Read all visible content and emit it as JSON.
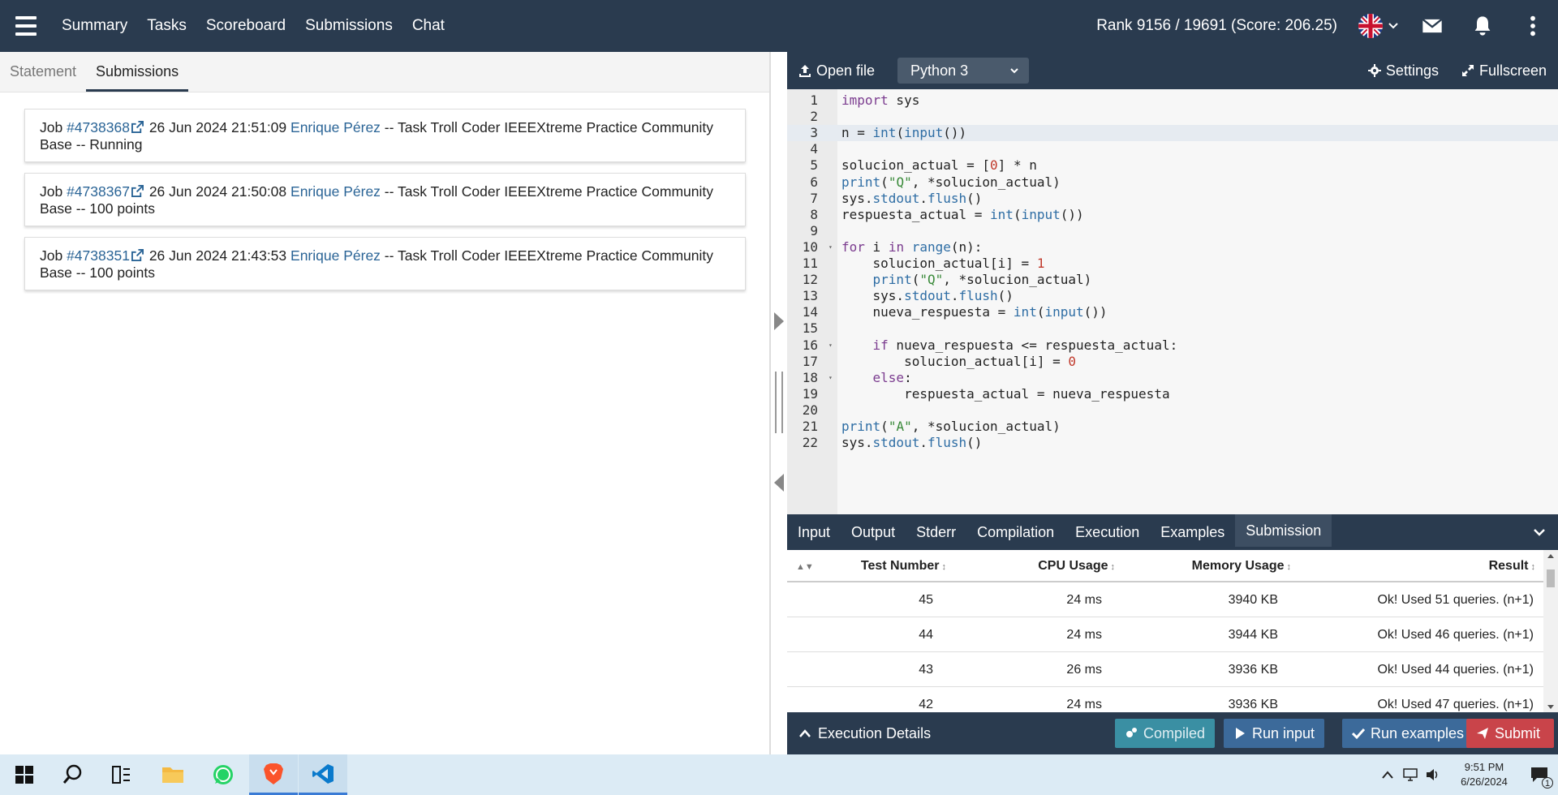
{
  "nav": {
    "links": [
      "Summary",
      "Tasks",
      "Scoreboard",
      "Submissions",
      "Chat"
    ],
    "rank": "Rank 9156 / 19691 (Score: 206.25)"
  },
  "left": {
    "tabs": [
      "Statement",
      "Submissions"
    ],
    "jobs": [
      {
        "prefix": "Job ",
        "id": "#4738368",
        "date": "26 Jun 2024 21:51:09",
        "user": "Enrique Pérez",
        "desc": " -- Task Troll Coder IEEEXtreme Practice Community Base -- Running"
      },
      {
        "prefix": "Job ",
        "id": "#4738367",
        "date": "26 Jun 2024 21:50:08",
        "user": "Enrique Pérez",
        "desc": " -- Task Troll Coder IEEEXtreme Practice Community Base -- 100 points"
      },
      {
        "prefix": "Job ",
        "id": "#4738351",
        "date": "26 Jun 2024 21:43:53",
        "user": "Enrique Pérez",
        "desc": " -- Task Troll Coder IEEEXtreme Practice Community Base -- 100 points"
      }
    ]
  },
  "editor": {
    "open_file": "Open file",
    "language": "Python 3",
    "settings": "Settings",
    "fullscreen": "Fullscreen",
    "lines": [
      "import sys",
      "",
      "n = int(input())",
      "",
      "solucion_actual = [0] * n",
      "print(\"Q\", *solucion_actual)",
      "sys.stdout.flush()",
      "respuesta_actual = int(input())",
      "",
      "for i in range(n):",
      "    solucion_actual[i] = 1",
      "    print(\"Q\", *solucion_actual)",
      "    sys.stdout.flush()",
      "    nueva_respuesta = int(input())",
      "",
      "    if nueva_respuesta <= respuesta_actual:",
      "        solucion_actual[i] = 0",
      "    else:",
      "        respuesta_actual = nueva_respuesta",
      "",
      "print(\"A\", *solucion_actual)",
      "sys.stdout.flush()"
    ],
    "active_line": 3
  },
  "output": {
    "tabs": [
      "Input",
      "Output",
      "Stderr",
      "Compilation",
      "Execution",
      "Examples",
      "Submission"
    ],
    "active_tab": "Submission",
    "columns": [
      "Test Number",
      "CPU Usage",
      "Memory Usage",
      "Result"
    ],
    "rows": [
      [
        "45",
        "24 ms",
        "3940 KB",
        "Ok! Used 51 queries. (n+1)"
      ],
      [
        "44",
        "24 ms",
        "3944 KB",
        "Ok! Used 46 queries. (n+1)"
      ],
      [
        "43",
        "26 ms",
        "3936 KB",
        "Ok! Used 44 queries. (n+1)"
      ],
      [
        "42",
        "24 ms",
        "3936 KB",
        "Ok! Used 47 queries. (n+1)"
      ]
    ]
  },
  "actions": {
    "exec_details": "Execution Details",
    "compiled": "Compiled",
    "run_input": "Run input",
    "run_examples": "Run examples",
    "submit": "Submit"
  },
  "taskbar": {
    "time": "9:51 PM",
    "date": "6/26/2024",
    "notif_count": "1"
  },
  "colors": {
    "nav_bg": "#2a3b4f",
    "link": "#2a6496",
    "compiled_btn": "#3a8fa3",
    "run_btn": "#3c6a9a",
    "submit_btn": "#c9444a"
  }
}
